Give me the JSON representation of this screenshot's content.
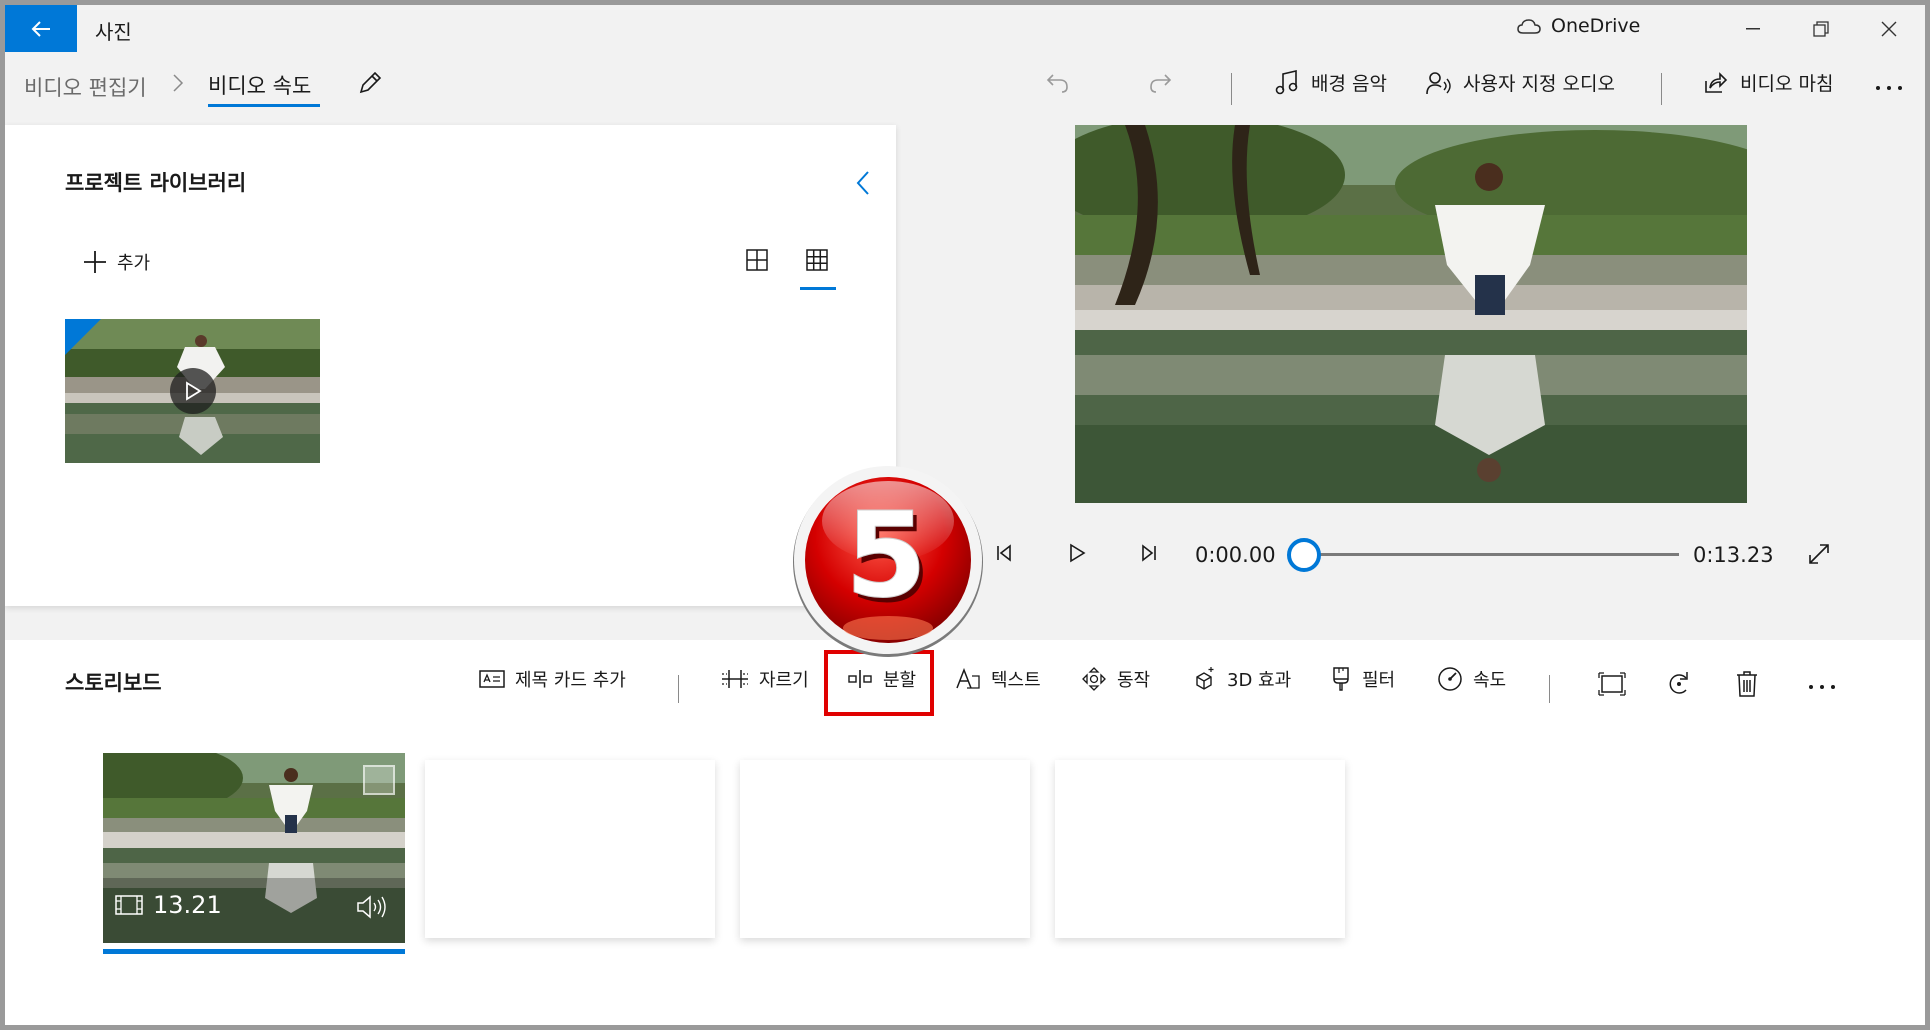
{
  "titlebar": {
    "app_title": "사진",
    "onedrive_label": "OneDrive"
  },
  "nav": {
    "breadcrumb_root": "비디오 편집기",
    "breadcrumb_current": "비디오 속도"
  },
  "toolbar": {
    "background_music": "배경 음악",
    "custom_audio": "사용자 지정 오디오",
    "finish_video": "비디오 마침"
  },
  "library": {
    "title": "프로젝트 라이브러리",
    "add_label": "추가"
  },
  "player": {
    "current_time": "0:00.00",
    "total_time": "0:13.23",
    "progress": 0.0
  },
  "storyboard": {
    "title": "스토리보드",
    "tools": {
      "title_card": "제목 카드 추가",
      "trim": "자르기",
      "split": "분할",
      "text": "텍스트",
      "motion": "동작",
      "effects_3d": "3D 효과",
      "filters": "필터",
      "speed": "속도"
    },
    "clip": {
      "duration": "13.21"
    }
  },
  "annotation": {
    "step_number": "5"
  },
  "colors": {
    "accent": "#0078d7",
    "highlight": "#e00000",
    "badge_red": "#d40000"
  }
}
